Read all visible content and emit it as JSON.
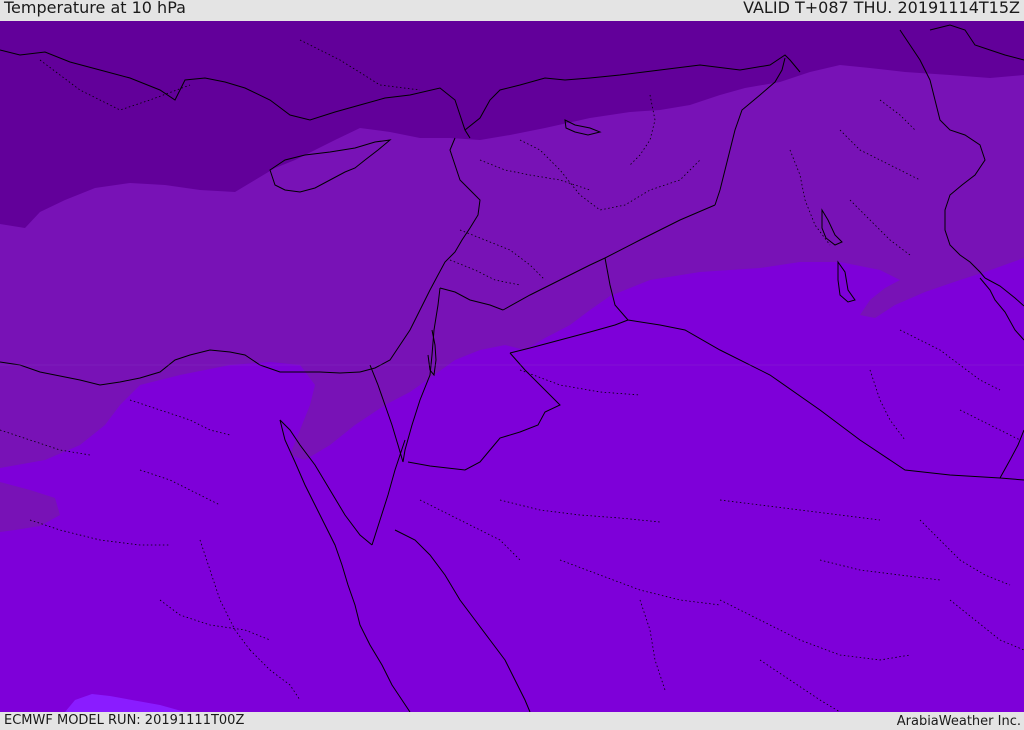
{
  "header": {
    "title": "Temperature at 10 hPa",
    "valid": "VALID T+087 THU. 20191114T15Z"
  },
  "footer": {
    "model_run": "ECMWF MODEL RUN: 20191111T00Z",
    "credit": "ArabiaWeather Inc."
  },
  "map": {
    "field": "temperature",
    "level": "10 hPa",
    "region": "Eastern Mediterranean and Middle East",
    "colors": {
      "cold_band": "#62009a",
      "mid_band": "#7812b6",
      "warm_band": "#7e00d9",
      "warmest_patch": "#8a1cff",
      "coastline": "#000000",
      "border": "#000000"
    }
  }
}
